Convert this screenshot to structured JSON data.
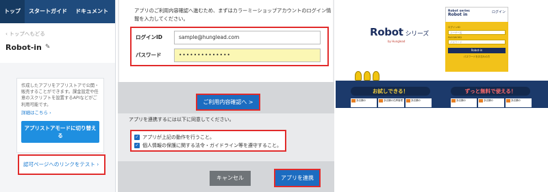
{
  "panel1": {
    "nav": [
      "トップ",
      "スタートガイド",
      "ドキュメント"
    ],
    "back_link": "‹ トップへもどる",
    "app_title": "Robot-in",
    "edit_icon": "pencil-icon",
    "description": "作成したアプリをアプリストアで公開・販売することができます。課金設定や任意のスクリプトを設置するAPIなどがご利用可能です。",
    "detail_link": "詳細はこちら ›",
    "store_mode_button": "アプリストアモードに切り替える",
    "test_link": "認可ページへのリンクをテスト ›"
  },
  "panel2": {
    "intro": "アプリのご利用内容確認へ進むため、まずはカラーミーショップアカウントのログイン情報を入力してください。",
    "login_id_label": "ログインID",
    "login_id_value": "sample@hunglead.com",
    "password_label": "パスワード",
    "password_value": "••••••••••••••",
    "confirm_button": "ご利用内容確認へ >",
    "agree_text": "アプリを連携するには以下に同意してください。",
    "checks": [
      "アプリが上記の動作を行うこと。",
      "個人情報の保護に関する法令・ガイドライン等を遵守すること。"
    ],
    "cancel_button": "キャンセル",
    "connect_button": "アプリを連携"
  },
  "panel3": {
    "logo": "Robot",
    "logo_series": "シリーズ",
    "logo_sub": "by Hunglead",
    "shot_logo_top": "Robot series",
    "shot_logo": "Robot in",
    "shot_login_link": "ログイン",
    "login_id_label": "ログインID",
    "login_id_placeholder": "ユーザー名",
    "password_label": "PASSWORD",
    "password_placeholder": "パスワード",
    "login_button": "Robot-in",
    "forgot": "パスワードをお忘れの方",
    "trial_label": "お試しできる！",
    "free_label": "ずっと無料で使える！",
    "card_text": "多店舗の",
    "card_text_2": "多店舗の在庫管理",
    "colors": {
      "navy": "#1c3a6b",
      "yellow": "#f2c21a"
    }
  }
}
